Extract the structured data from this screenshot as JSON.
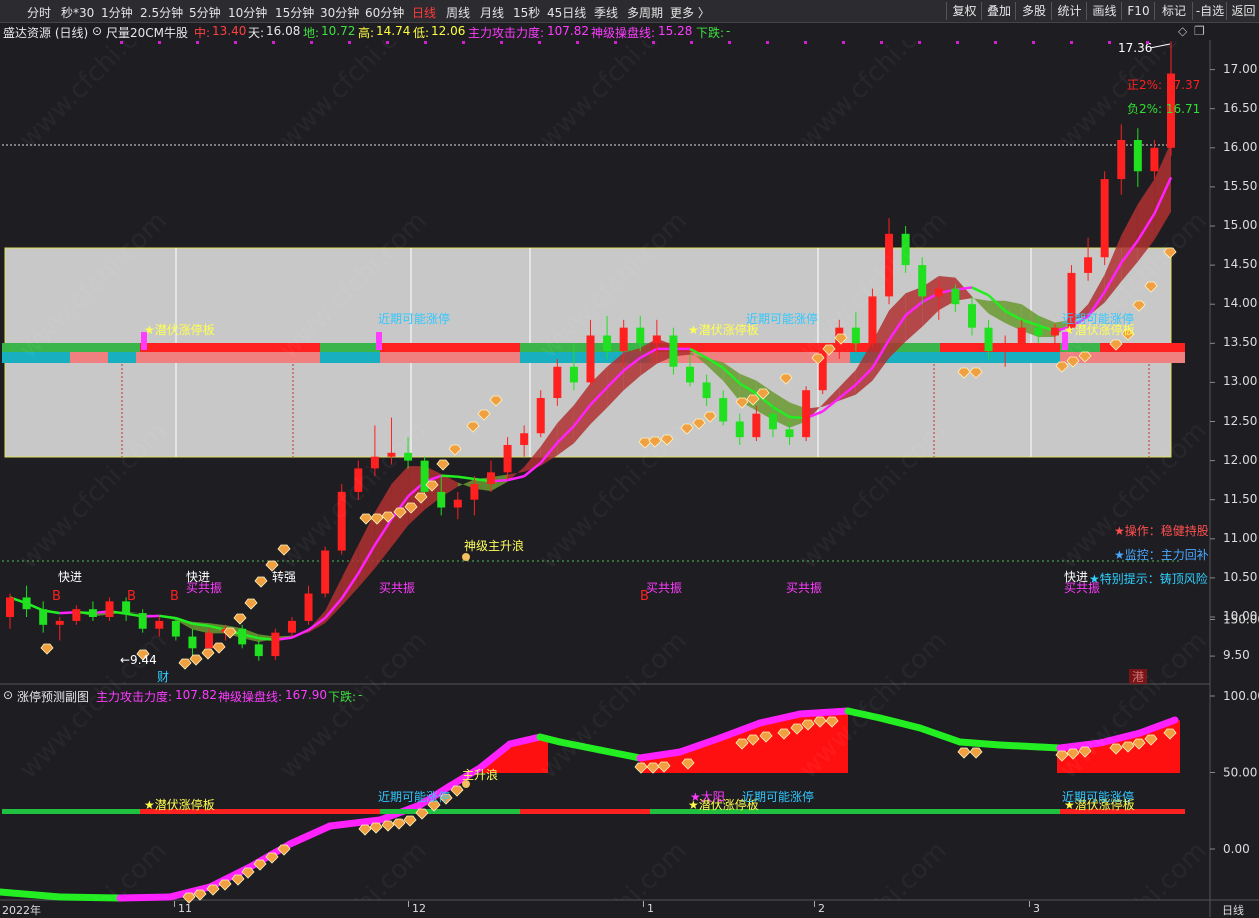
{
  "toolbar": {
    "periods": [
      "分时",
      "秒*30",
      "1分钟",
      "2.5分钟",
      "5分钟",
      "10分钟",
      "15分钟",
      "30分钟",
      "60分钟",
      "日线",
      "周线",
      "月线",
      "15秒",
      "45日线",
      "季线",
      "多周期",
      "更多 〉"
    ],
    "active_period": "日线",
    "right": [
      "复权",
      "叠加",
      "多股",
      "统计",
      "画线",
      "F10",
      "标记",
      "-自选",
      "返回"
    ]
  },
  "info": {
    "title": "盛达资源 (日线)",
    "indicator": "尺量20CM牛股",
    "zhong_label": "中:",
    "zhong": "13.40",
    "tian_label": "天:",
    "tian": "16.08",
    "di_label": "地:",
    "di": "10.72",
    "gao_label": "高:",
    "gao": "14.74",
    "low_label": "低:",
    "low": "12.06",
    "force_label": "主力攻击力度:",
    "force": "107.82",
    "line_label": "神级操盘线:",
    "line": "15.28",
    "down_label": "下跌:",
    "down": "-"
  },
  "sub_info": {
    "title": "涨停预测副图",
    "force_label": "主力攻击力度:",
    "force": "107.82",
    "line_label": "神级操盘线:",
    "line": "167.90",
    "down_label": "下跌:",
    "down": "-"
  },
  "axis": {
    "main_ticks": [
      "17.00",
      "16.50",
      "16.00",
      "15.50",
      "15.00",
      "14.50",
      "14.00",
      "13.50",
      "13.00",
      "12.50",
      "12.00",
      "11.50",
      "11.00",
      "10.50",
      "10.00",
      "9.50"
    ],
    "sub_ticks": [
      "150.00",
      "100.00",
      "50.00",
      "0.00"
    ],
    "dates": [
      "2022年",
      "11",
      "12",
      "1",
      "2",
      "3"
    ],
    "period_label": "日线"
  },
  "annotations": {
    "high_price": "17.36",
    "low_price": "9.44",
    "zheng": "正2%: 17.37",
    "fu": "负2%: 16.71",
    "op": "★操作：稳健持股",
    "monitor": "★监控：主力回补",
    "special": "★特别提示：铸顶风险",
    "wave": "神级主升浪",
    "wave_sub": "主升浪",
    "ambush": "★潜伏涨停板",
    "maybe": "近期可能涨停",
    "resonance": "买共振",
    "fast": "快进",
    "strong": "转强",
    "cai": "财",
    "gang": "港",
    "b": "B",
    "big_yang": "★大阳"
  },
  "colors": {
    "up": "#ff2020",
    "down": "#20e020",
    "band": "#c8c8c8",
    "magenta": "#ff22ff",
    "yellow": "#ffff40",
    "cyan": "#30c8ff",
    "bg": "#1d1d22"
  },
  "chart_data": {
    "type": "candlestick",
    "title": "盛达资源 (日线)",
    "ylim": [
      9.2,
      17.45
    ],
    "candles": [
      [
        10.0,
        10.3,
        9.85,
        10.25
      ],
      [
        10.25,
        10.4,
        10.0,
        10.1
      ],
      [
        10.1,
        10.2,
        9.8,
        9.9
      ],
      [
        9.9,
        10.0,
        9.7,
        9.95
      ],
      [
        9.95,
        10.15,
        9.9,
        10.1
      ],
      [
        10.1,
        10.2,
        9.95,
        10.0
      ],
      [
        10.0,
        10.25,
        9.95,
        10.2
      ],
      [
        10.2,
        10.25,
        9.95,
        10.05
      ],
      [
        10.05,
        10.1,
        9.8,
        9.85
      ],
      [
        9.85,
        10.0,
        9.75,
        9.95
      ],
      [
        9.95,
        10.0,
        9.7,
        9.75
      ],
      [
        9.75,
        9.85,
        9.5,
        9.6
      ],
      [
        9.6,
        9.85,
        9.55,
        9.8
      ],
      [
        9.8,
        9.9,
        9.7,
        9.85
      ],
      [
        9.85,
        9.9,
        9.6,
        9.65
      ],
      [
        9.65,
        9.7,
        9.44,
        9.5
      ],
      [
        9.5,
        9.85,
        9.45,
        9.8
      ],
      [
        9.8,
        10.0,
        9.75,
        9.95
      ],
      [
        9.95,
        10.4,
        9.9,
        10.3
      ],
      [
        10.3,
        10.9,
        10.25,
        10.85
      ],
      [
        10.85,
        11.7,
        10.8,
        11.6
      ],
      [
        11.6,
        12.0,
        11.5,
        11.9
      ],
      [
        11.9,
        12.45,
        11.8,
        12.05
      ],
      [
        12.05,
        12.55,
        11.95,
        12.1
      ],
      [
        12.1,
        12.3,
        11.9,
        12.0
      ],
      [
        12.0,
        12.05,
        11.5,
        11.6
      ],
      [
        11.6,
        11.8,
        11.3,
        11.4
      ],
      [
        11.4,
        11.6,
        11.25,
        11.5
      ],
      [
        11.5,
        11.8,
        11.3,
        11.7
      ],
      [
        11.7,
        12.0,
        11.6,
        11.85
      ],
      [
        11.85,
        12.3,
        11.75,
        12.2
      ],
      [
        12.2,
        12.45,
        12.05,
        12.35
      ],
      [
        12.35,
        12.9,
        12.3,
        12.8
      ],
      [
        12.8,
        13.3,
        12.7,
        13.2
      ],
      [
        13.2,
        13.5,
        12.9,
        13.0
      ],
      [
        13.0,
        13.8,
        12.95,
        13.6
      ],
      [
        13.6,
        13.85,
        13.3,
        13.4
      ],
      [
        13.4,
        13.8,
        13.2,
        13.7
      ],
      [
        13.7,
        13.85,
        13.4,
        13.5
      ],
      [
        13.5,
        13.8,
        13.35,
        13.6
      ],
      [
        13.6,
        13.7,
        13.1,
        13.2
      ],
      [
        13.2,
        13.35,
        12.95,
        13.0
      ],
      [
        13.0,
        13.1,
        12.7,
        12.8
      ],
      [
        12.8,
        12.9,
        12.45,
        12.5
      ],
      [
        12.5,
        12.6,
        12.2,
        12.3
      ],
      [
        12.3,
        12.7,
        12.25,
        12.6
      ],
      [
        12.6,
        12.7,
        12.3,
        12.4
      ],
      [
        12.4,
        12.5,
        12.2,
        12.3
      ],
      [
        12.3,
        12.95,
        12.25,
        12.9
      ],
      [
        12.9,
        13.5,
        12.85,
        13.4
      ],
      [
        13.4,
        13.8,
        13.3,
        13.7
      ],
      [
        13.7,
        13.9,
        13.4,
        13.5
      ],
      [
        13.5,
        14.2,
        13.45,
        14.1
      ],
      [
        14.1,
        15.1,
        14.0,
        14.9
      ],
      [
        14.9,
        15.0,
        14.4,
        14.5
      ],
      [
        14.5,
        14.6,
        14.0,
        14.1
      ],
      [
        14.1,
        14.3,
        13.8,
        14.2
      ],
      [
        14.2,
        14.25,
        13.9,
        14.0
      ],
      [
        14.0,
        14.1,
        13.6,
        13.7
      ],
      [
        13.7,
        13.8,
        13.3,
        13.4
      ],
      [
        13.4,
        13.6,
        13.2,
        13.5
      ],
      [
        13.5,
        13.8,
        13.4,
        13.7
      ],
      [
        13.7,
        13.85,
        13.5,
        13.6
      ],
      [
        13.6,
        13.75,
        13.45,
        13.7
      ],
      [
        13.7,
        14.5,
        13.65,
        14.4
      ],
      [
        14.4,
        14.85,
        14.3,
        14.6
      ],
      [
        14.6,
        15.7,
        14.5,
        15.6
      ],
      [
        15.6,
        16.3,
        15.4,
        16.1
      ],
      [
        16.1,
        16.25,
        15.5,
        15.7
      ],
      [
        15.7,
        16.1,
        15.6,
        16.0
      ],
      [
        16.0,
        17.36,
        15.9,
        16.95
      ]
    ]
  }
}
